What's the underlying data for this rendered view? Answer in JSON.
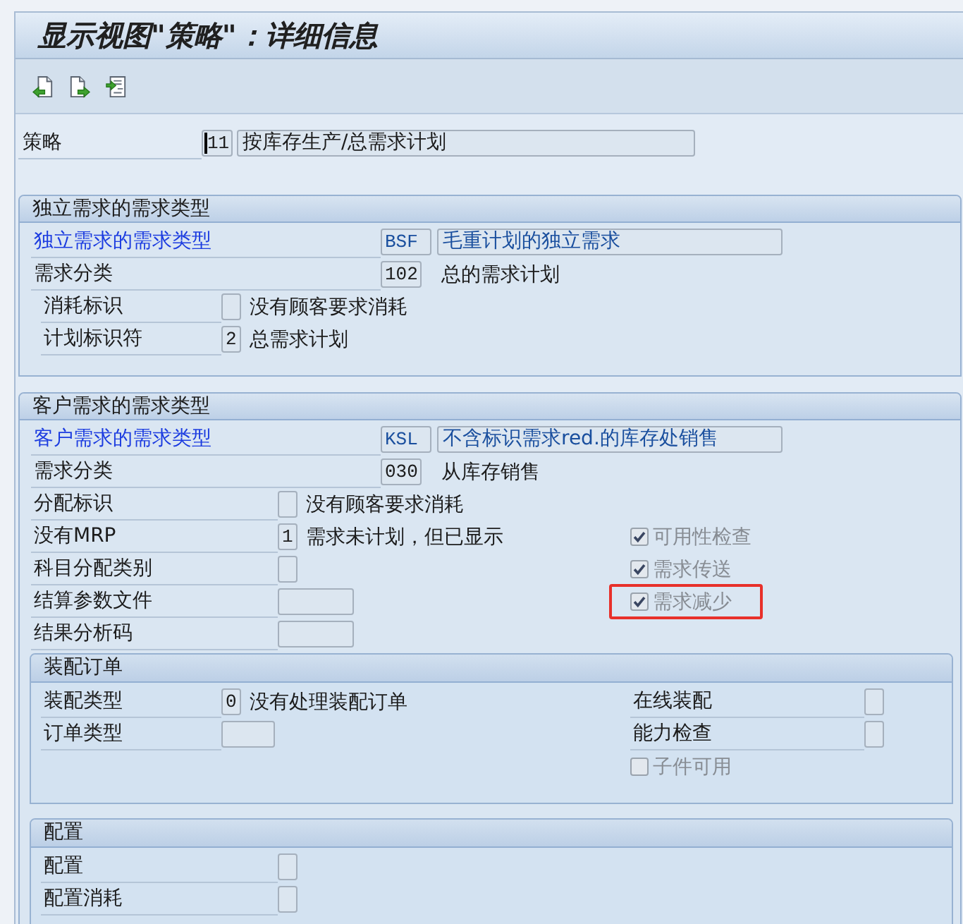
{
  "window": {
    "title": "显示视图\"策略\"：详细信息"
  },
  "strategy": {
    "label": "策略",
    "code": "11",
    "focused": true,
    "description": "按库存生产/总需求计划"
  },
  "independent_requirements": {
    "title": "独立需求的需求类型",
    "requirement_type": {
      "label": "独立需求的需求类型",
      "code": "BSF",
      "description": "毛重计划的独立需求"
    },
    "requirement_class": {
      "label": "需求分类",
      "code": "102",
      "text": "总的需求计划"
    },
    "fields": [
      {
        "kind": "indicator",
        "label": "消耗标识",
        "text": "没有顾客要求消耗"
      },
      {
        "kind": "indicator",
        "label": "计划标识符",
        "value": "2",
        "text": "总需求计划"
      }
    ]
  },
  "customer_requirements": {
    "title": "客户需求的需求类型",
    "requirement_type": {
      "label": "客户需求的需求类型",
      "code": "KSL",
      "description": "不含标识需求red.的库存处销售"
    },
    "requirement_class": {
      "label": "需求分类",
      "code": "030",
      "text": "从库存销售"
    },
    "fields": [
      {
        "kind": "indicator",
        "label": "分配标识",
        "text": "没有顾客要求消耗"
      },
      {
        "kind": "indicator",
        "label": "没有MRP",
        "value": "1",
        "text": "需求未计划，但已显示"
      },
      {
        "kind": "indicator",
        "label": "科目分配类别"
      },
      {
        "kind": "input",
        "label": "结算参数文件"
      },
      {
        "kind": "input",
        "label": "结果分析码"
      }
    ],
    "options": [
      {
        "kind": "checkbox",
        "label": "可用性检查",
        "checked": true,
        "disabled": true,
        "highlighted": false
      },
      {
        "kind": "checkbox",
        "label": "需求传送",
        "checked": true,
        "disabled": true,
        "highlighted": false
      },
      {
        "kind": "checkbox",
        "label": "需求减少",
        "checked": true,
        "disabled": true,
        "highlighted": true
      }
    ],
    "assembly_order": {
      "title": "装配订单",
      "fields": [
        {
          "kind": "indicator",
          "label": "装配类型",
          "value": "0",
          "text": "没有处理装配订单"
        },
        {
          "kind": "input",
          "label": "订单类型"
        }
      ],
      "options": [
        {
          "kind": "indicator",
          "label": "在线装配"
        },
        {
          "kind": "indicator",
          "label": "能力检查"
        },
        {
          "kind": "checkbox",
          "label": "子件可用",
          "checked": false,
          "disabled": true,
          "highlighted": false
        }
      ]
    },
    "configuration": {
      "title": "配置",
      "fields": [
        {
          "kind": "indicator",
          "label": "配置"
        },
        {
          "kind": "indicator",
          "label": "配置消耗"
        }
      ]
    }
  }
}
